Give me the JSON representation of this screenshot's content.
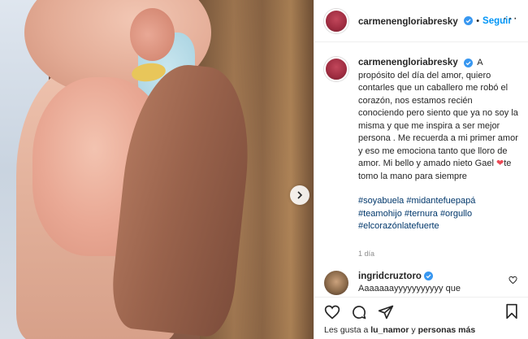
{
  "post": {
    "username": "carmenengloriabresky",
    "follow_label": "Seguir",
    "more_label": "···",
    "caption": "A propósito del día del amor, quiero contarles que un caballero me robó el corazón, nos estamos recién conociendo pero siento que ya no soy la misma y que me inspira a ser mejor persona . Me recuerda a mi primer amor y eso me emociona tanto que lloro de amor. Mi bello y amado nieto Gael",
    "caption_heart": "❤",
    "caption_end": "te tomo la mano para siempre",
    "hashtags": [
      "#soyabuela",
      "#midantefuepapá",
      "#teamohijo",
      "#ternura",
      "#orgullo",
      "#elcorazónlatefuerte"
    ],
    "time": "1 día"
  },
  "comment": {
    "username": "ingridcruztoro",
    "text": "Aaaaaaayyyyyyyyyyy que hermosoooooooooooooo",
    "hearts": "❤❤❤❤",
    "hearts_overflow": "❤❤❤❤"
  },
  "likes": {
    "prefix": "Les gusta a",
    "user": "lu_namor",
    "conj": "y",
    "others": "personas más"
  },
  "colors": {
    "link": "#0095f6",
    "hashtag": "#00376b",
    "heart": "#ed4956",
    "muted": "#8e8e8e"
  }
}
